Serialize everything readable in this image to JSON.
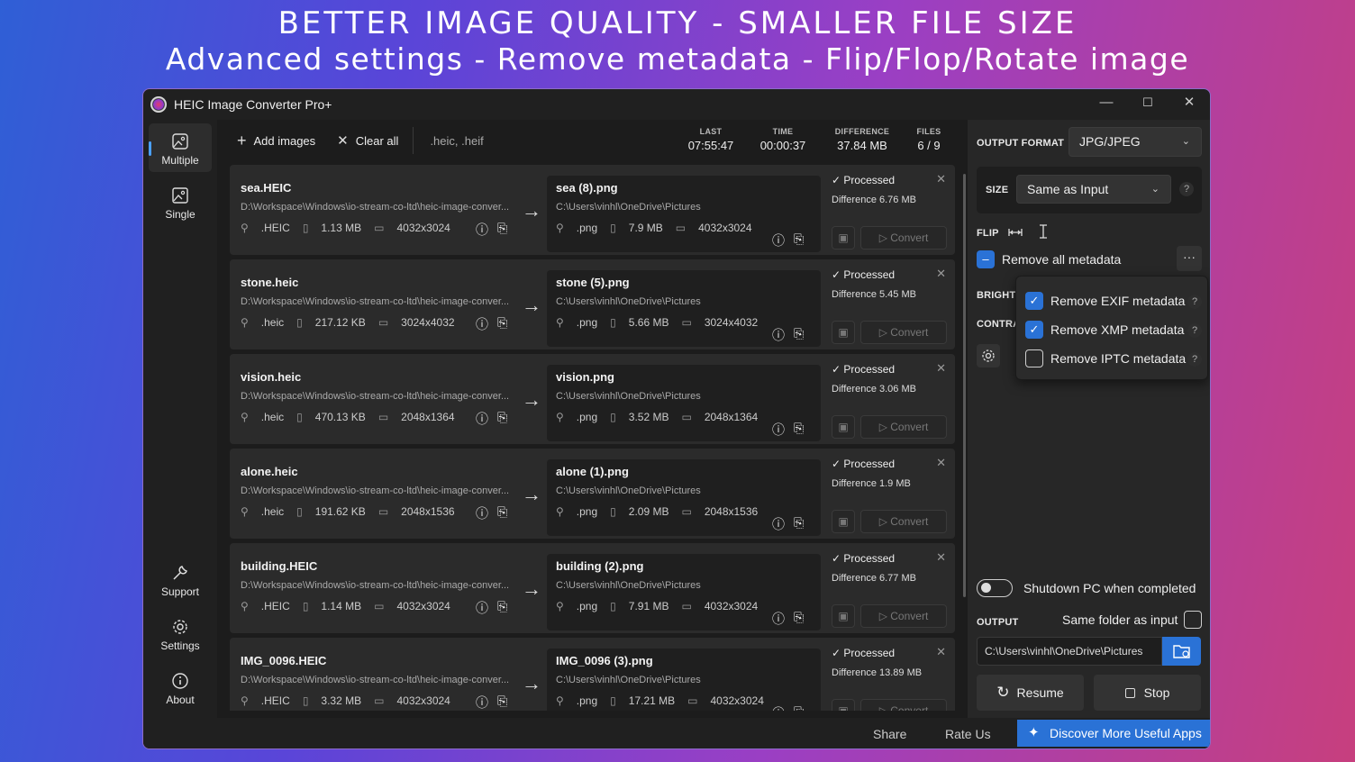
{
  "promo": {
    "headline": "BETTER IMAGE QUALITY - SMALLER FILE SIZE",
    "subline": "Advanced settings - Remove metadata - Flip/Flop/Rotate image"
  },
  "window": {
    "title": "HEIC Image Converter Pro+",
    "controls": {
      "minimize": "—",
      "maximize": "☐",
      "close": "✕"
    }
  },
  "nav": {
    "multiple": "Multiple",
    "single": "Single",
    "support": "Support",
    "settings": "Settings",
    "about": "About"
  },
  "toolbar": {
    "add_images": "Add images",
    "clear_all": "Clear all",
    "extensions": ".heic, .heif",
    "stats": [
      {
        "label": "LAST",
        "value": "07:55:47"
      },
      {
        "label": "TIME",
        "value": "00:00:37"
      },
      {
        "label": "DIFFERENCE",
        "value": "37.84 MB"
      },
      {
        "label": "FILES",
        "value": "6 / 9"
      }
    ]
  },
  "files": [
    {
      "src_name": "sea.HEIC",
      "src_path": "D:\\Workspace\\Windows\\io-stream-co-ltd\\heic-image-conver...",
      "src_ext": ".HEIC",
      "src_size": "1.13 MB",
      "src_dim": "4032x3024",
      "dst_name": "sea (8).png",
      "dst_path": "C:\\Users\\vinhl\\OneDrive\\Pictures",
      "dst_ext": ".png",
      "dst_size": "7.9 MB",
      "dst_dim": "4032x3024",
      "status": "Processed",
      "diff": "Difference 6.76 MB",
      "convert": "Convert"
    },
    {
      "src_name": "stone.heic",
      "src_path": "D:\\Workspace\\Windows\\io-stream-co-ltd\\heic-image-conver...",
      "src_ext": ".heic",
      "src_size": "217.12 KB",
      "src_dim": "3024x4032",
      "dst_name": "stone (5).png",
      "dst_path": "C:\\Users\\vinhl\\OneDrive\\Pictures",
      "dst_ext": ".png",
      "dst_size": "5.66 MB",
      "dst_dim": "3024x4032",
      "status": "Processed",
      "diff": "Difference 5.45 MB",
      "convert": "Convert"
    },
    {
      "src_name": "vision.heic",
      "src_path": "D:\\Workspace\\Windows\\io-stream-co-ltd\\heic-image-conver...",
      "src_ext": ".heic",
      "src_size": "470.13 KB",
      "src_dim": "2048x1364",
      "dst_name": "vision.png",
      "dst_path": "C:\\Users\\vinhl\\OneDrive\\Pictures",
      "dst_ext": ".png",
      "dst_size": "3.52 MB",
      "dst_dim": "2048x1364",
      "status": "Processed",
      "diff": "Difference 3.06 MB",
      "convert": "Convert"
    },
    {
      "src_name": "alone.heic",
      "src_path": "D:\\Workspace\\Windows\\io-stream-co-ltd\\heic-image-conver...",
      "src_ext": ".heic",
      "src_size": "191.62 KB",
      "src_dim": "2048x1536",
      "dst_name": "alone (1).png",
      "dst_path": "C:\\Users\\vinhl\\OneDrive\\Pictures",
      "dst_ext": ".png",
      "dst_size": "2.09 MB",
      "dst_dim": "2048x1536",
      "status": "Processed",
      "diff": "Difference 1.9 MB",
      "convert": "Convert"
    },
    {
      "src_name": "building.HEIC",
      "src_path": "D:\\Workspace\\Windows\\io-stream-co-ltd\\heic-image-conver...",
      "src_ext": ".HEIC",
      "src_size": "1.14 MB",
      "src_dim": "4032x3024",
      "dst_name": "building (2).png",
      "dst_path": "C:\\Users\\vinhl\\OneDrive\\Pictures",
      "dst_ext": ".png",
      "dst_size": "7.91 MB",
      "dst_dim": "4032x3024",
      "status": "Processed",
      "diff": "Difference 6.77 MB",
      "convert": "Convert"
    },
    {
      "src_name": "IMG_0096.HEIC",
      "src_path": "D:\\Workspace\\Windows\\io-stream-co-ltd\\heic-image-conver...",
      "src_ext": ".HEIC",
      "src_size": "3.32 MB",
      "src_dim": "4032x3024",
      "dst_name": "IMG_0096 (3).png",
      "dst_path": "C:\\Users\\vinhl\\OneDrive\\Pictures",
      "dst_ext": ".png",
      "dst_size": "17.21 MB",
      "dst_dim": "4032x3024",
      "status": "Processed",
      "diff": "Difference 13.89 MB",
      "convert": "Convert"
    }
  ],
  "panel": {
    "output_format_label": "OUTPUT FORMAT",
    "output_format_value": "JPG/JPEG",
    "size_label": "SIZE",
    "size_value": "Same as Input",
    "flip_label": "FLIP",
    "remove_all_metadata": "Remove all metadata",
    "remove_all_checked": true,
    "brightness_label": "BRIGHT",
    "contrast_label": "CONTRA",
    "metadata_options": [
      {
        "label": "Remove EXIF metadata",
        "checked": true
      },
      {
        "label": "Remove XMP metadata",
        "checked": true
      },
      {
        "label": "Remove IPTC metadata",
        "checked": false
      }
    ],
    "shutdown_label": "Shutdown PC when completed",
    "shutdown_on": false,
    "output_label": "OUTPUT",
    "same_folder_label": "Same folder as input",
    "same_folder_checked": false,
    "output_path": "C:\\Users\\vinhl\\OneDrive\\Pictures",
    "resume": "Resume",
    "stop": "Stop"
  },
  "bottom": {
    "share": "Share",
    "rate": "Rate Us",
    "discover": "Discover More Useful Apps"
  },
  "colors": {
    "accent": "#2a72d6",
    "window_bg": "#202020",
    "panel_bg": "#272727"
  }
}
